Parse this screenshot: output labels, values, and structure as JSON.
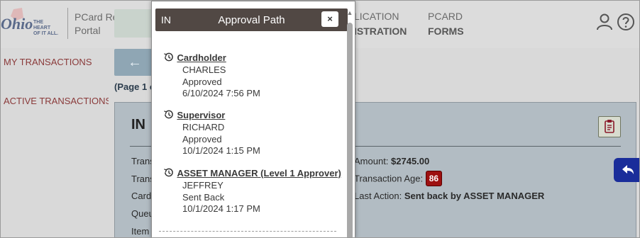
{
  "header": {
    "portal_title_line1": "PCard Reconciliati",
    "portal_title_line2": "Portal",
    "nav_application_line1": "LICATION",
    "nav_application_line2": "ISTRATION",
    "nav_pcard_line1": "PCARD",
    "nav_pcard_line2": "FORMS",
    "logo_text_line1": "THE",
    "logo_text_line2": "HEART",
    "logo_text_line3": "OF IT ALL."
  },
  "sidebar": {
    "items": [
      {
        "label": "MY TRANSACTIONS"
      },
      {
        "label": "ACTIVE TRANSACTIONS"
      }
    ]
  },
  "main": {
    "back_icon": "←",
    "page_indicator": "(Page 1 o",
    "card_title": "IN",
    "left_labels": [
      "Trans",
      "Trans",
      "Card",
      "Queu",
      "Item"
    ],
    "amount_label": "Amount: ",
    "amount_value": "$2745.00",
    "age_label": "Transaction Age: ",
    "age_value": "86",
    "last_action_label": "Last Action: ",
    "last_action_value": "Sent back by ASSET MANAGER"
  },
  "modal": {
    "code": "IN",
    "title": "Approval Path",
    "close_label": "×",
    "steps": [
      {
        "role": "Cardholder",
        "name": "CHARLES",
        "status": "Approved",
        "datetime": "6/10/2024 7:56 PM"
      },
      {
        "role": "Supervisor",
        "name": "RICHARD",
        "status": "Approved",
        "datetime": "10/1/2024 1:15 PM"
      },
      {
        "role": "ASSET MANAGER (Level 1 Approver)",
        "name": "JEFFREY",
        "status": "Sent Back",
        "datetime": "10/1/2024 1:17 PM"
      }
    ]
  },
  "icons": {
    "history": "history-icon",
    "user": "user-icon",
    "help": "help-icon",
    "clipboard": "clipboard-icon",
    "reply": "reply-icon"
  },
  "colors": {
    "modal_header": "#514844",
    "badge": "#9d1010",
    "float_button": "#1a2d9a",
    "link_red": "#8a3a3a"
  }
}
